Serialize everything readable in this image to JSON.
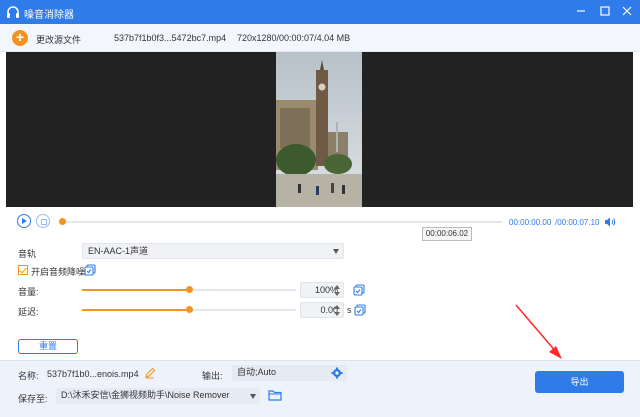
{
  "window": {
    "title": "噪音消除器"
  },
  "toolbar": {
    "change_source_label": "更改源文件",
    "file_name": "537b7f1b0f3...5472bc7.mp4",
    "file_info": "720x1280/00:00:07/4.04 MB"
  },
  "player": {
    "current_time": "00:00:00.00",
    "total_time": "/00:00:07.10",
    "hover_time": "00:00:06.02",
    "progress": 0
  },
  "settings": {
    "audio_track_label": "音轨",
    "audio_track_value": "EN-AAC-1声道",
    "enable_denoise_label": "开启音频降噪",
    "enable_denoise_checked": true,
    "volume_label": "音量:",
    "volume_value": "100%",
    "volume_fraction": 0.5,
    "delay_label": "延迟:",
    "delay_value": "0.00",
    "delay_unit": "s",
    "delay_fraction": 0.5,
    "reset_label": "重置"
  },
  "footer": {
    "name_label": "名称:",
    "name_value": "537b7f1b0...enois.mp4",
    "output_label": "输出:",
    "output_value": "自动;Auto",
    "save_label": "保存至:",
    "save_path": "D:\\沐禾安信\\金狮视频助手\\Noise Remover",
    "export_label": "导出"
  },
  "colors": {
    "accent": "#2f7be9",
    "orange": "#f39422",
    "annotation": "#ff2a2a"
  },
  "icons": [
    "headphones-icon",
    "minimize-icon",
    "maximize-icon",
    "close-icon",
    "add-icon",
    "play-icon",
    "stop-icon",
    "volume-icon",
    "copy-settings-icon",
    "edit-icon",
    "gear-icon",
    "folder-icon"
  ]
}
